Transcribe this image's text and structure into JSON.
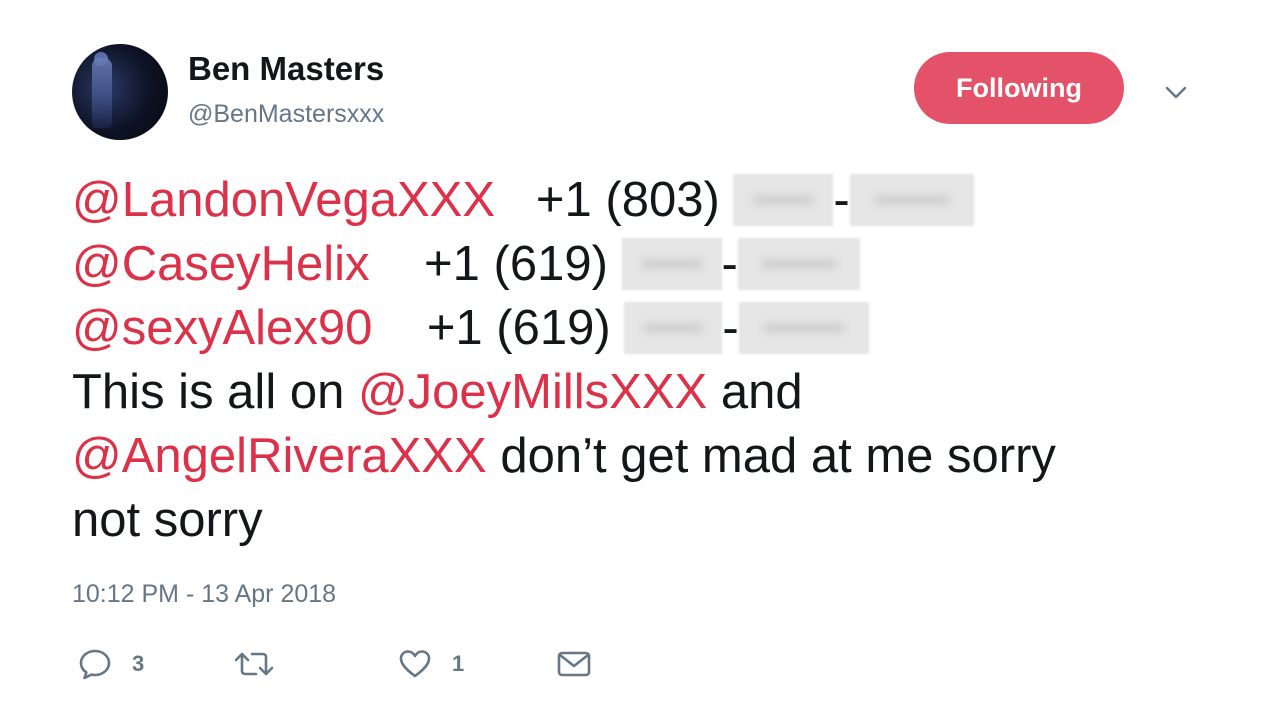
{
  "user": {
    "display_name": "Ben Masters",
    "handle": "@BenMastersxxx"
  },
  "follow_button": {
    "label": "Following",
    "color": "#e35268"
  },
  "tweet": {
    "lines": [
      {
        "mention": "@LandonVegaXXX",
        "phone_prefix": "+1 (803)",
        "dash": "-"
      },
      {
        "mention": "@CaseyHelix",
        "phone_prefix": "+1 (619)",
        "dash": "-"
      },
      {
        "mention": "@sexyAlex90",
        "phone_prefix": "+1 (619)",
        "dash": "-"
      }
    ],
    "line4_text": "This is all on ",
    "line4_mention": "@JoeyMillsXXX",
    "line4_suffix": " and",
    "line5_mention": "@AngelRiveraXXX",
    "line5_text": " don’t get mad at me sorry",
    "line6_text": "not sorry",
    "mention_color": "#dc3148"
  },
  "timestamp": "10:12 PM - 13 Apr 2018",
  "actions": {
    "reply": {
      "icon": "reply-icon",
      "count": "3"
    },
    "retweet": {
      "icon": "retweet-icon",
      "count": ""
    },
    "like": {
      "icon": "heart-icon",
      "count": "1"
    },
    "message": {
      "icon": "envelope-icon"
    }
  }
}
